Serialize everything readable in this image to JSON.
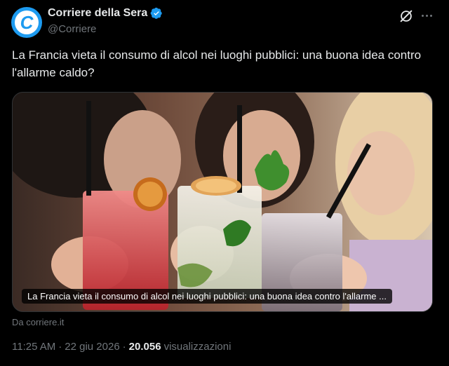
{
  "account": {
    "display_name": "Corriere della Sera",
    "handle": "@Corriere",
    "avatar_letter": "C",
    "verified": true
  },
  "actions": {
    "grok_icon": "grok-icon",
    "more_icon": "more-icon"
  },
  "tweet": {
    "text": "La Francia vieta il consumo di alcol nei luoghi pubblici: una buona idea contro l'allarme caldo?"
  },
  "card": {
    "caption": "La Francia vieta il consumo di alcol nei luoghi pubblici: una buona idea contro l'allarme ...",
    "source": "Da corriere.it"
  },
  "meta": {
    "time": "11:25 AM",
    "separator": "·",
    "date": "22 giu 2026",
    "views_count": "20.056",
    "views_label": "visualizzazioni"
  },
  "colors": {
    "accent": "#1d9bf0",
    "background": "#000000",
    "text": "#e7e9ea",
    "muted": "#71767b"
  }
}
